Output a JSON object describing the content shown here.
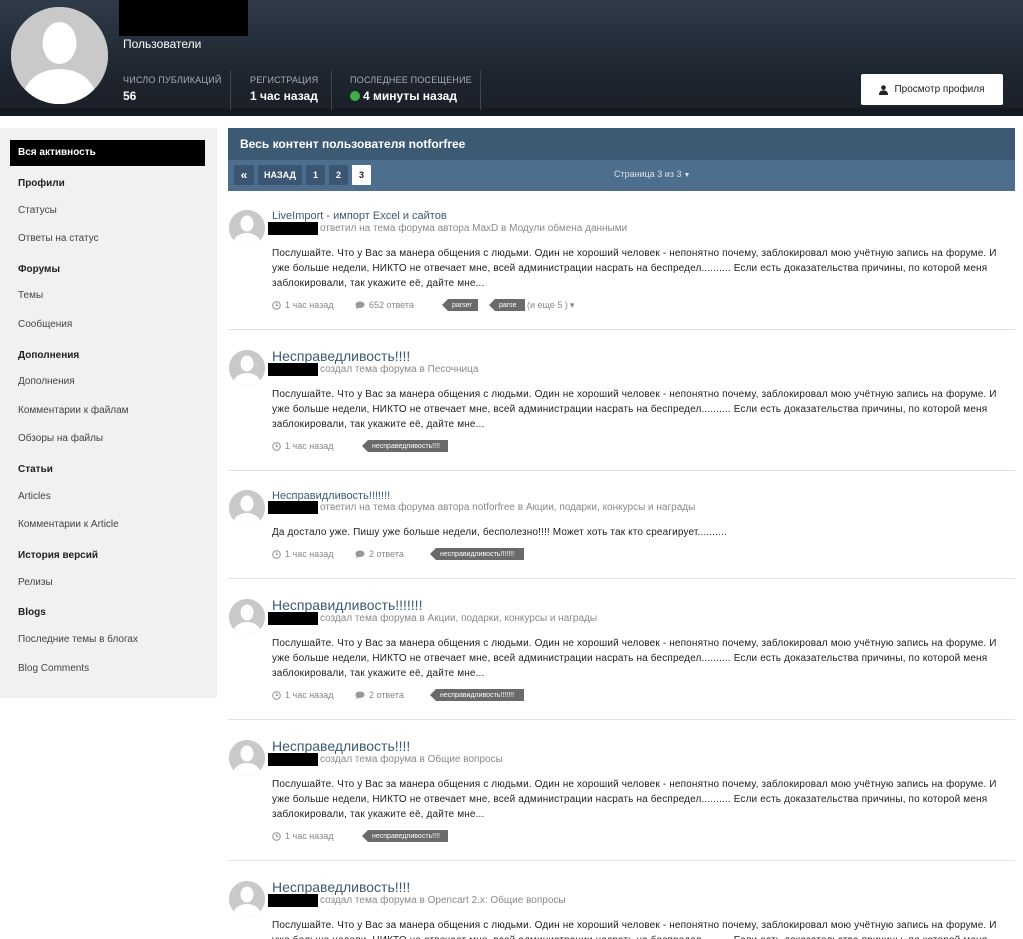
{
  "profile": {
    "group": "Пользователи",
    "stats": [
      {
        "label": "Число публикаций",
        "value": "56"
      },
      {
        "label": "Регистрация",
        "value": "1 час назад"
      },
      {
        "label": "Последнее посещение",
        "value": "4 минуты назад"
      }
    ],
    "online_color": "#3fae49",
    "view_profile": "Просмотр профиля"
  },
  "sidebar": {
    "active": "Вся активность",
    "sections": [
      {
        "heading": "Профили",
        "items": [
          "Статусы",
          "Ответы на статус"
        ]
      },
      {
        "heading": "Форумы",
        "items": [
          "Темы",
          "Сообщения"
        ]
      },
      {
        "heading": "Дополнения",
        "items": [
          "Дополнения",
          "Комментарии к файлам",
          "Обзоры на файлы"
        ]
      },
      {
        "heading": "Статьи",
        "items": [
          "Articles",
          "Комментарии к Article"
        ]
      },
      {
        "heading": "История версий",
        "items": [
          "Релизы"
        ]
      },
      {
        "heading": "Blogs",
        "items": [
          "Последние темы в блогах",
          "Blog Comments"
        ]
      }
    ]
  },
  "main": {
    "title": "Весь контент пользователя notforfree",
    "pager": {
      "first": "«",
      "prev": "НАЗАД",
      "pages": [
        "1",
        "2",
        "3"
      ],
      "current": "3",
      "info": "Страница 3 из 3"
    },
    "posts": [
      {
        "title": "LiveImport - импорт Excel и сайтов",
        "meta": "ответил на тема форума автора MaxD в Модули обмена данными",
        "body": "Послушайте. Что у Вас за манера общения с людьми. Один не хороший человек - непонятно почему, заблокировал мою учётную запись на форуме. И уже больше недели, НИКТО не отвечает мне, всей администрации насрать на беспредел.......... Если есть доказательства причины, по которой меня заблокировали, так укажите её, дайте мне...",
        "time": "1 час назад",
        "replies": "652 ответа",
        "tags": [
          "parser",
          "parse"
        ],
        "more": "(и еще 5 )"
      },
      {
        "title": "Несправедливость!!!!",
        "meta": "создал тема форума в Песочница",
        "body": "Послушайте. Что у Вас за манера общения с людьми. Один не хороший человек - непонятно почему, заблокировал мою учётную запись на форуме. И уже больше недели, НИКТО не отвечает мне, всей администрации насрать на беспредел.......... Если есть доказательства причины, по которой меня заблокировали, так укажите её, дайте мне...",
        "time": "1 час назад",
        "replies": "",
        "tags": [
          "несправедливость!!!!"
        ],
        "more": ""
      },
      {
        "title": "Несправидливость!!!!!!!",
        "meta": "ответил на тема форума автора notforfree в Акции, подарки, конкурсы и награды",
        "body": "Да достало уже. Пишу уже больше недели, бесполезно!!!! Может хоть так кто среагирует..........",
        "time": "1 час назад",
        "replies": "2 ответа",
        "tags": [
          "несправидливость!!!!!!!"
        ],
        "more": ""
      },
      {
        "title": "Несправидливость!!!!!!!",
        "meta": "создал тема форума в Акции, подарки, конкурсы и награды",
        "body": "Послушайте. Что у Вас за манера общения с людьми. Один не хороший человек - непонятно почему, заблокировал мою учётную запись на форуме. И уже больше недели, НИКТО не отвечает мне, всей администрации насрать на беспредел.......... Если есть доказательства причины, по которой меня заблокировали, так укажите её, дайте мне...",
        "time": "1 час назад",
        "replies": "2 ответа",
        "tags": [
          "несправидливость!!!!!!!"
        ],
        "more": ""
      },
      {
        "title": "Несправедливость!!!!",
        "meta": "создал тема форума в Общие вопросы",
        "body": "Послушайте. Что у Вас за манера общения с людьми. Один не хороший человек - непонятно почему, заблокировал мою учётную запись на форуме. И уже больше недели, НИКТО не отвечает мне, всей администрации насрать на беспредел.......... Если есть доказательства причины, по которой меня заблокировали, так укажите её, дайте мне...",
        "time": "1 час назад",
        "replies": "",
        "tags": [
          "несправедливость!!!!"
        ],
        "more": ""
      },
      {
        "title": "Несправедливость!!!!",
        "meta": "создал тема форума в Opencart 2.x: Общие вопросы",
        "body": "Послушайте. Что у Вас за манера общения с людьми. Один не хороший человек - непонятно почему, заблокировал мою учётную запись на форуме. И уже больше недели, НИКТО не отвечает мне, всей администрации насрать на беспредел.......... Если есть доказательства причины, по которой меня заблокировали, так укажите её, дайте мне...",
        "time": "",
        "replies": "",
        "tags": [],
        "more": ""
      }
    ]
  }
}
